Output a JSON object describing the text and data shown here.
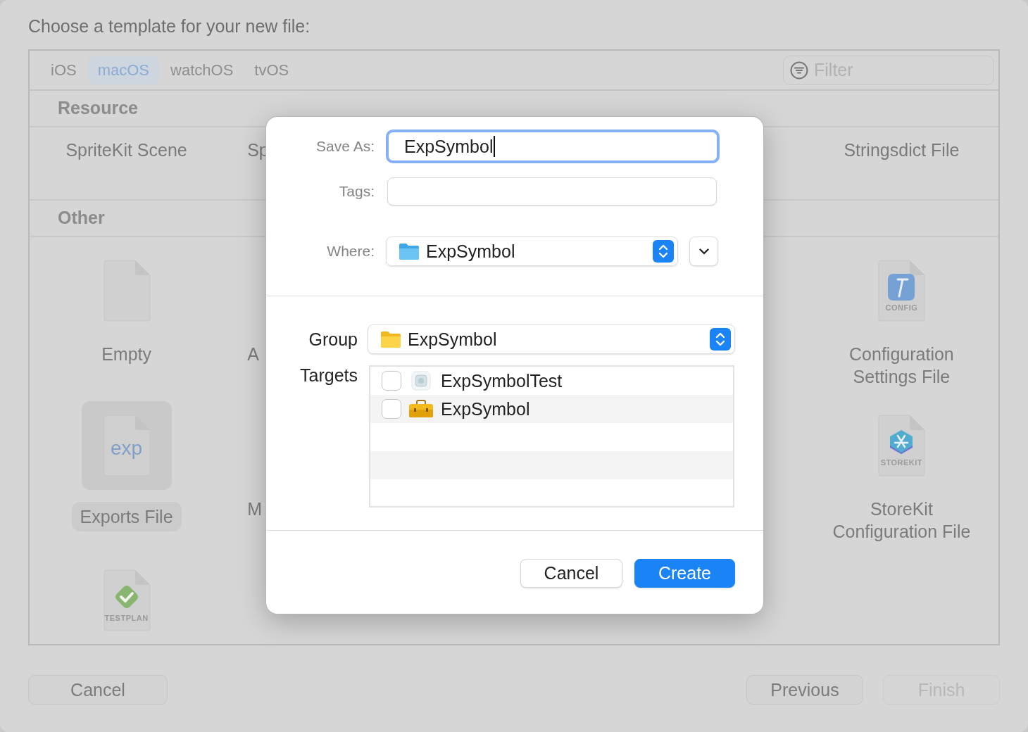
{
  "window": {
    "title": "Choose a template for your new file:"
  },
  "platform_tabs": [
    {
      "label": "iOS",
      "selected": false
    },
    {
      "label": "macOS",
      "selected": true
    },
    {
      "label": "watchOS",
      "selected": false
    },
    {
      "label": "tvOS",
      "selected": false
    }
  ],
  "filter": {
    "placeholder": "Filter"
  },
  "sections": [
    {
      "title": "Resource",
      "rows": [
        [
          {
            "kind": "text",
            "label": "SpriteKit Scene",
            "selected": false
          },
          {
            "kind": "partial",
            "label": "Sp"
          },
          null,
          null,
          {
            "kind": "text",
            "label": "Stringsdict File",
            "selected": false
          }
        ]
      ]
    },
    {
      "title": "Other",
      "rows": [
        [
          {
            "kind": "blank",
            "label": "Empty",
            "selected": false
          },
          {
            "kind": "partial",
            "label": "A"
          },
          null,
          null,
          {
            "kind": "config",
            "label": "Configuration Settings File",
            "caption": "CONFIG",
            "selected": false
          }
        ],
        [
          {
            "kind": "exp",
            "label": "Exports File",
            "caption": "exp",
            "selected": true
          },
          {
            "kind": "partial",
            "label": "M"
          },
          null,
          null,
          {
            "kind": "storekit",
            "label": "StoreKit Configuration File",
            "caption": "STOREKIT",
            "selected": false
          }
        ],
        [
          {
            "kind": "testplan",
            "caption": "TESTPLAN",
            "selected": false
          },
          null,
          null,
          null,
          null
        ]
      ]
    }
  ],
  "footer_buttons": [
    {
      "label": "Cancel",
      "disabled": false
    },
    {
      "label": "Previous",
      "disabled": false
    },
    {
      "label": "Finish",
      "disabled": true
    }
  ],
  "dialog": {
    "save_as": {
      "label": "Save As:",
      "value": "ExpSymbol"
    },
    "tags": {
      "label": "Tags:"
    },
    "where": {
      "label": "Where:",
      "value": "ExpSymbol"
    },
    "group": {
      "label": "Group",
      "value": "ExpSymbol"
    },
    "targets": {
      "label": "Targets",
      "items": [
        {
          "label": "ExpSymbolTest",
          "checked": false
        },
        {
          "label": "ExpSymbol",
          "checked": false
        }
      ]
    },
    "buttons": [
      {
        "label": "Cancel",
        "kind": "secondary"
      },
      {
        "label": "Create",
        "kind": "primary"
      }
    ]
  }
}
